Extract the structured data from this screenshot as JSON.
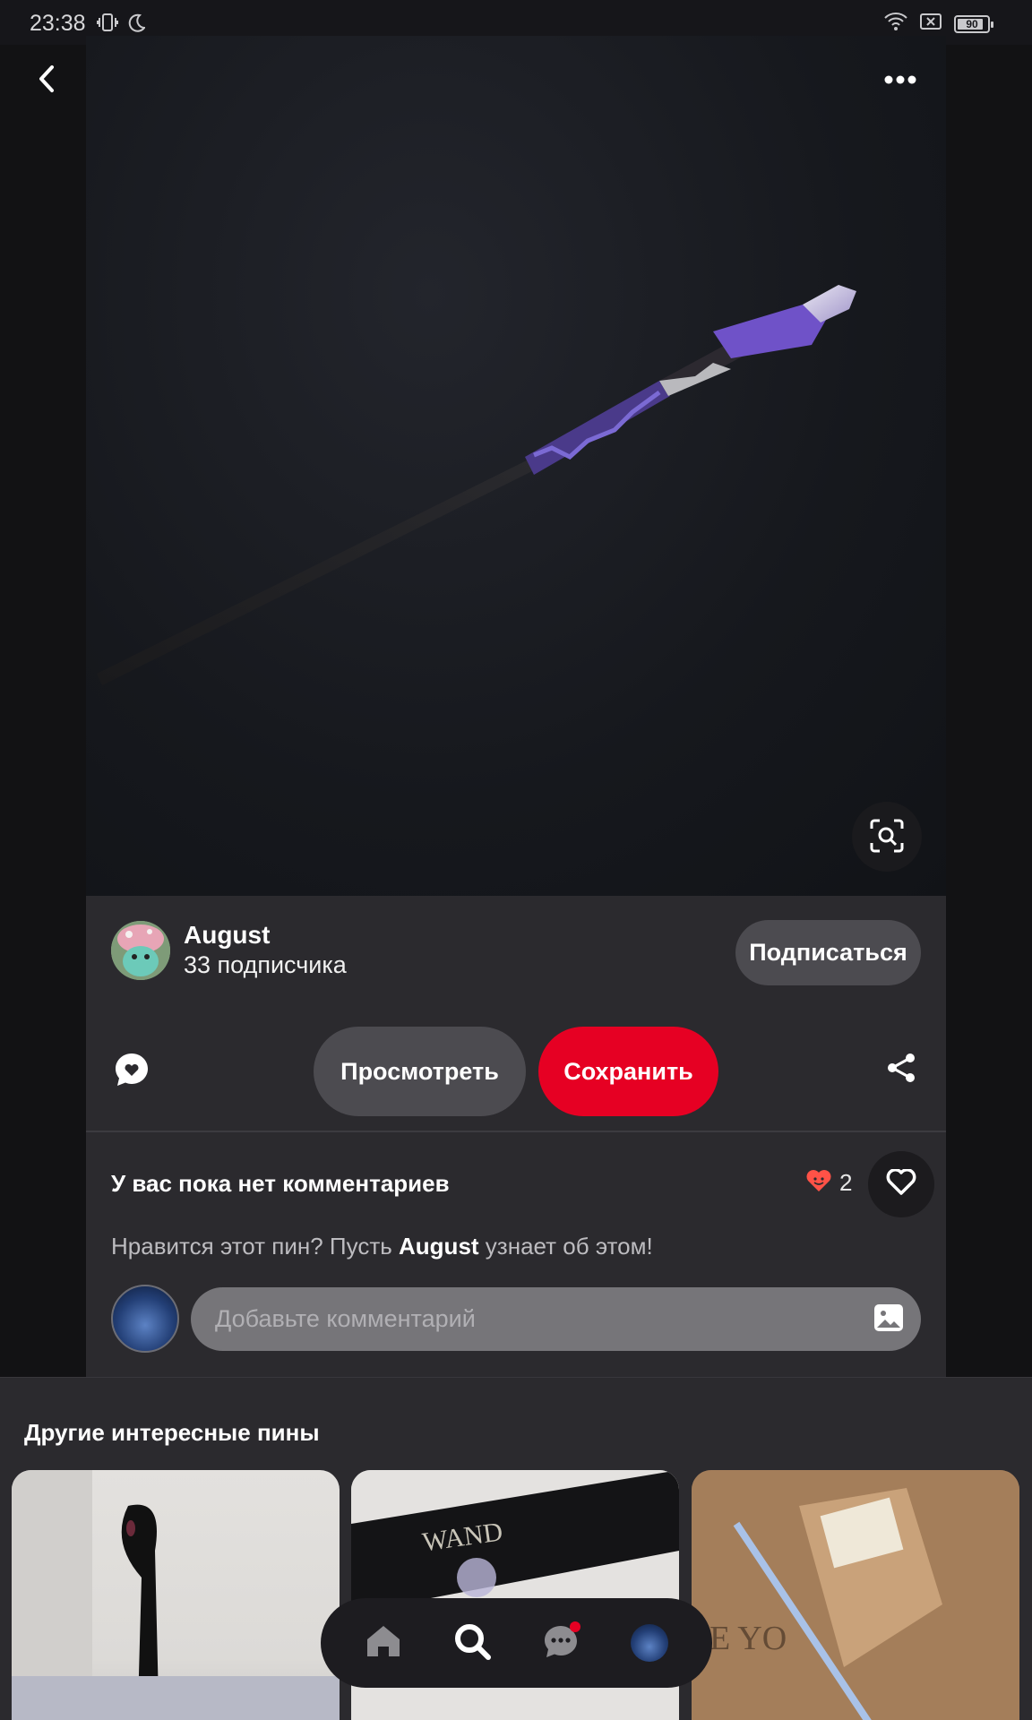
{
  "status_bar": {
    "time": "23:38",
    "battery": "90",
    "icons": [
      "vibrate-icon",
      "moon-icon",
      "wifi-icon",
      "no-sim-icon",
      "battery-icon"
    ]
  },
  "top_bar": {
    "back_icon": "chevron-left-icon",
    "more_icon": "ellipsis-icon"
  },
  "pin": {
    "image_alt": "wand-image",
    "lens_icon": "visual-search-icon"
  },
  "creator": {
    "name": "August",
    "followers": "33 подписчика",
    "follow_label": "Подписаться"
  },
  "actions": {
    "view_label": "Просмотреть",
    "save_label": "Сохранить",
    "comment_icon": "comment-heart-icon",
    "share_icon": "share-icon"
  },
  "comments": {
    "heading": "У вас пока нет комментариев",
    "reaction_count": "2",
    "prompt_prefix": "Нравится этот пин? Пусть ",
    "prompt_name": "August",
    "prompt_suffix": " узнает об этом!",
    "input_placeholder": "Добавьте комментарий"
  },
  "more_pins": {
    "title": "Другие интересные пины"
  },
  "bottom_nav": {
    "items": [
      "home-icon",
      "search-icon",
      "messages-icon",
      "profile-avatar"
    ]
  },
  "colors": {
    "save": "#e60023",
    "card": "#2b2a2e",
    "button": "#4c4b50"
  }
}
